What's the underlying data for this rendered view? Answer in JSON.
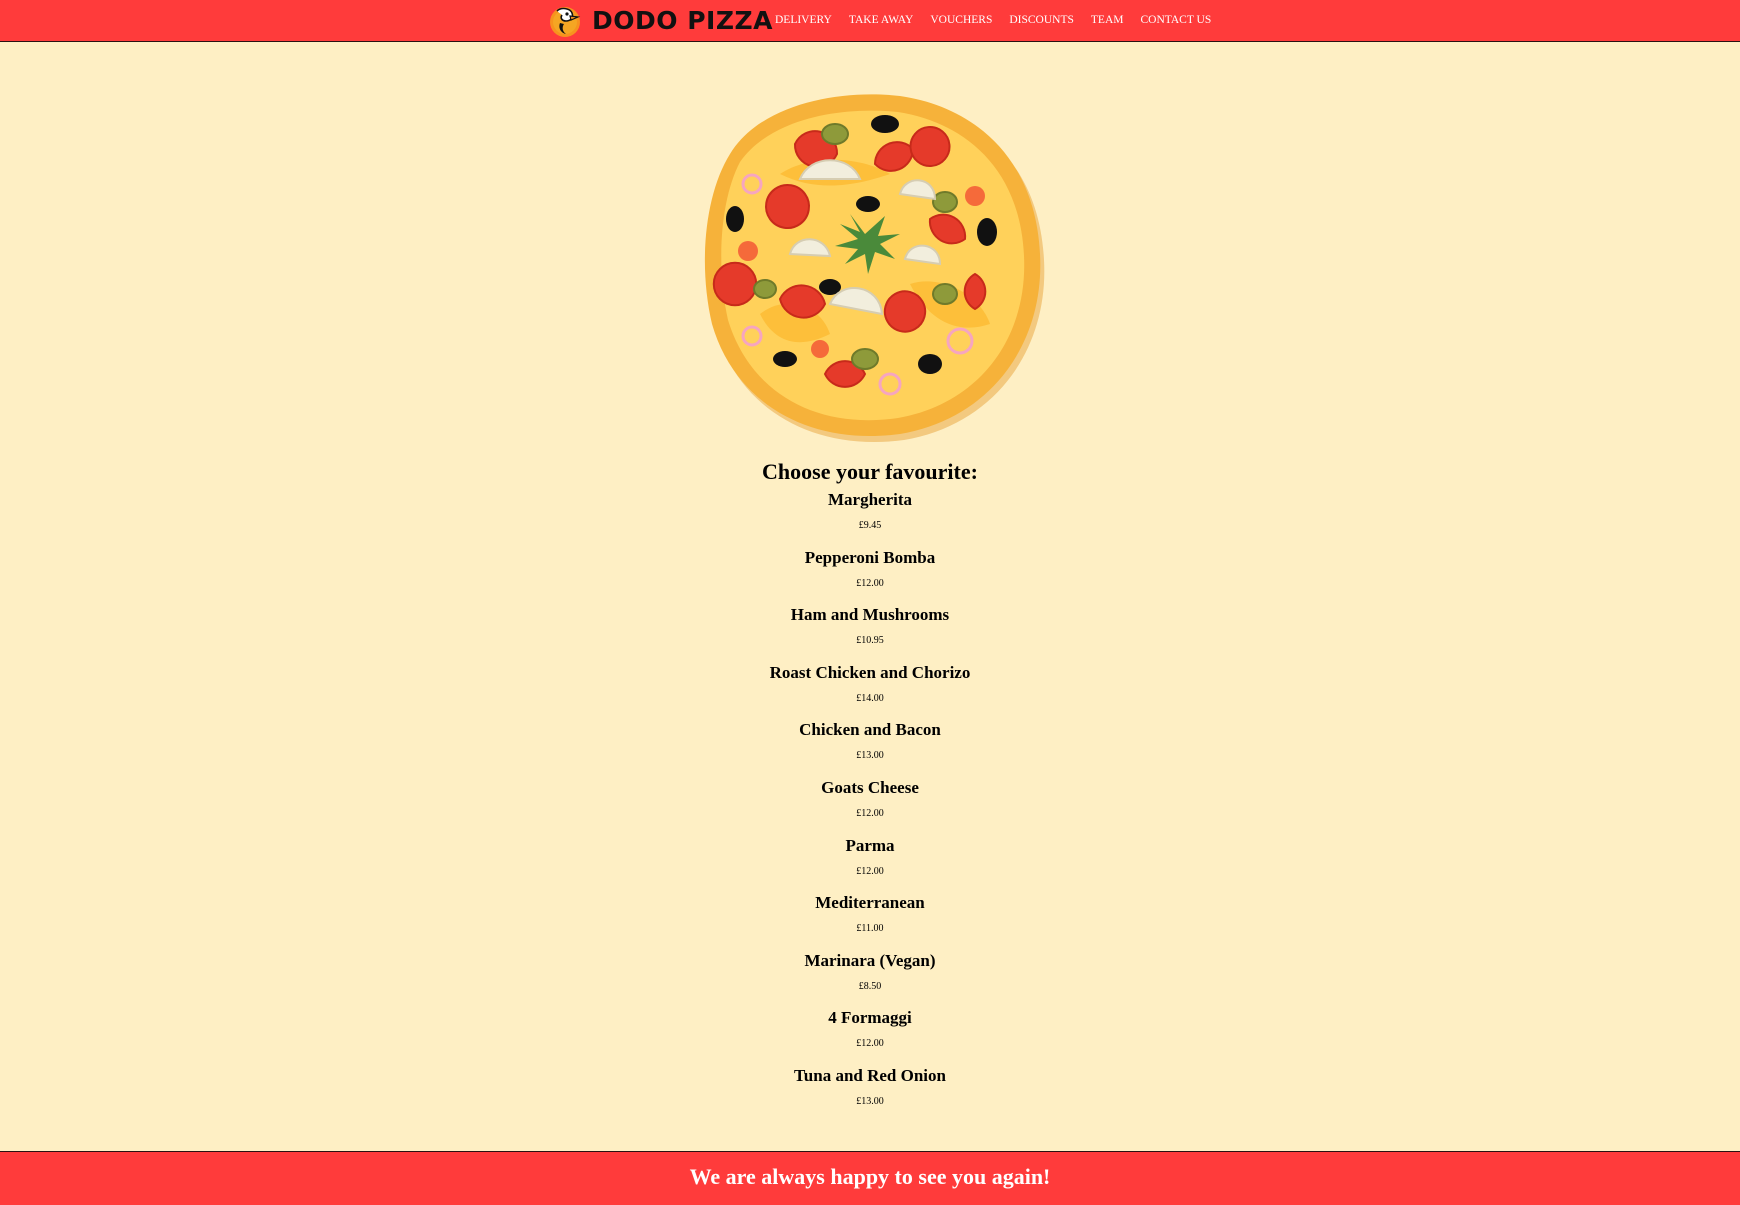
{
  "brand": {
    "name": "DODO PIZZA",
    "logo_icon": "dodo-bird-icon",
    "accent_color": "#FF3B3B",
    "background_color": "#FEEFC4"
  },
  "nav": {
    "items": [
      {
        "label": "DELIVERY"
      },
      {
        "label": "TAKE AWAY"
      },
      {
        "label": "VOUCHERS"
      },
      {
        "label": "DISCOUNTS"
      },
      {
        "label": "TEAM"
      },
      {
        "label": "CONTACT US"
      }
    ]
  },
  "hero": {
    "image": "pizza-illustration"
  },
  "menu": {
    "title": "Choose your favourite:",
    "items": [
      {
        "name": "Margherita",
        "price": "£9.45"
      },
      {
        "name": "Pepperoni Bomba",
        "price": "£12.00"
      },
      {
        "name": "Ham and Mushrooms",
        "price": "£10.95"
      },
      {
        "name": "Roast Chicken and Chorizo",
        "price": "£14.00"
      },
      {
        "name": "Chicken and Bacon",
        "price": "£13.00"
      },
      {
        "name": "Goats Cheese",
        "price": "£12.00"
      },
      {
        "name": "Parma",
        "price": "£12.00"
      },
      {
        "name": "Mediterranean",
        "price": "£11.00"
      },
      {
        "name": "Marinara (Vegan)",
        "price": "£8.50"
      },
      {
        "name": "4 Formaggi",
        "price": "£12.00"
      },
      {
        "name": "Tuna and Red Onion",
        "price": "£13.00"
      }
    ]
  },
  "footer": {
    "text": "We are always happy to see you again!"
  }
}
